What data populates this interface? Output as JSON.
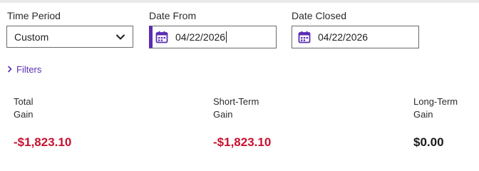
{
  "colors": {
    "accent": "#5a2db3",
    "negative": "#c8102e",
    "neutral": "#1a1a1a"
  },
  "time_period": {
    "label": "Time Period",
    "selected": "Custom",
    "icon": "chevron-down-icon"
  },
  "date_from": {
    "label": "Date From",
    "value": "04/22/2026",
    "icon": "calendar-icon"
  },
  "date_closed": {
    "label": "Date Closed",
    "value": "04/22/2026",
    "icon": "calendar-icon"
  },
  "filters": {
    "label": "Filters",
    "icon": "chevron-right-icon"
  },
  "stats": {
    "total": {
      "label_line1": "Total",
      "label_line2": "Gain",
      "value": "-$1,823.10"
    },
    "short_term": {
      "label_line1": "Short-Term",
      "label_line2": "Gain",
      "value": "-$1,823.10"
    },
    "long_term": {
      "label_line1": "Long-Term",
      "label_line2": "Gain",
      "value": "$0.00"
    }
  }
}
